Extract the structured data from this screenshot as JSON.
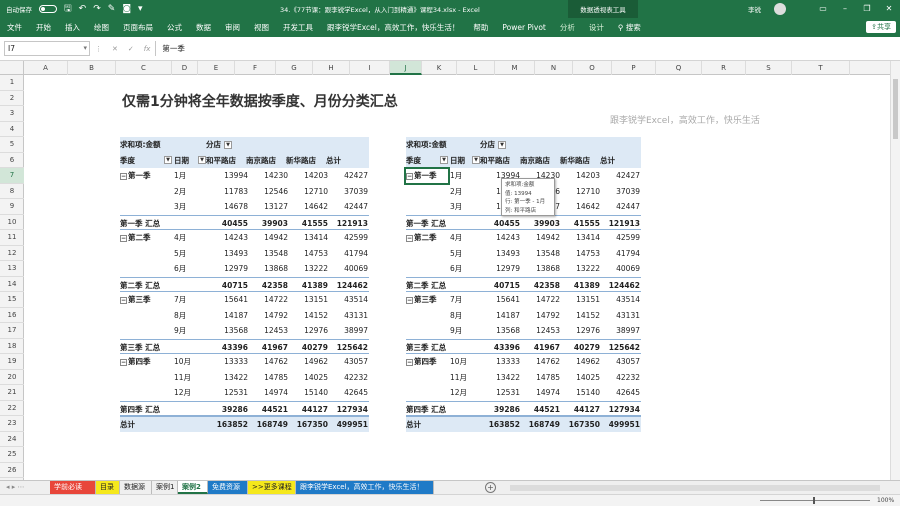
{
  "titlebar": {
    "autosave_label": "自动保存",
    "toggle_state": "关",
    "document_title": "34.《77节课：跟李锐学Excel，从入门到精通》课程34.xlsx - Excel",
    "context_tab_group": "数据透视表工具",
    "user_name": "李锐"
  },
  "ribbon": {
    "tabs": [
      "文件",
      "开始",
      "插入",
      "绘图",
      "页面布局",
      "公式",
      "数据",
      "审阅",
      "视图",
      "开发工具",
      "跟李锐学Excel，高效工作，快乐生活！",
      "帮助",
      "Power Pivot"
    ],
    "context_tabs": [
      "分析",
      "设计"
    ],
    "search_label": "搜索",
    "share_label": "共享"
  },
  "formula_bar": {
    "name_box": "I7",
    "value": "第一季"
  },
  "columns": [
    "A",
    "B",
    "C",
    "D",
    "E",
    "F",
    "G",
    "H",
    "I",
    "J",
    "K",
    "L",
    "M",
    "N",
    "O",
    "P",
    "Q",
    "R",
    "S",
    "T"
  ],
  "selected_column": "J",
  "rows": [
    "1",
    "2",
    "3",
    "4",
    "5",
    "6",
    "7",
    "8",
    "9",
    "10",
    "11",
    "12",
    "13",
    "14",
    "15",
    "16",
    "17",
    "18",
    "19",
    "20",
    "21",
    "22",
    "23",
    "24",
    "25",
    "26"
  ],
  "selected_row": "7",
  "sheet": {
    "title": "仅需1分钟将全年数据按季度、月份分类汇总",
    "subtitle": "跟李锐学Excel，高效工作，快乐生活"
  },
  "pivot": {
    "value_field": "求和项:金额",
    "column_field": "分店",
    "row_field_1": "季度",
    "row_field_2": "日期",
    "stores": [
      "和平路店",
      "南京路店",
      "新华路店"
    ],
    "grand_total_label": "总计",
    "rows": [
      {
        "kind": "data",
        "quarter": "第一季",
        "month": "1月",
        "v": [
          "13994",
          "14230",
          "14203",
          "42427"
        ]
      },
      {
        "kind": "data",
        "quarter": "",
        "month": "2月",
        "v": [
          "11783",
          "12546",
          "12710",
          "37039"
        ]
      },
      {
        "kind": "data",
        "quarter": "",
        "month": "3月",
        "v": [
          "14678",
          "13127",
          "14642",
          "42447"
        ]
      },
      {
        "kind": "sub",
        "quarter": "第一季 汇总",
        "month": "",
        "v": [
          "40455",
          "39903",
          "41555",
          "121913"
        ]
      },
      {
        "kind": "data",
        "quarter": "第二季",
        "month": "4月",
        "v": [
          "14243",
          "14942",
          "13414",
          "42599"
        ]
      },
      {
        "kind": "data",
        "quarter": "",
        "month": "5月",
        "v": [
          "13493",
          "13548",
          "14753",
          "41794"
        ]
      },
      {
        "kind": "data",
        "quarter": "",
        "month": "6月",
        "v": [
          "12979",
          "13868",
          "13222",
          "40069"
        ]
      },
      {
        "kind": "sub",
        "quarter": "第二季 汇总",
        "month": "",
        "v": [
          "40715",
          "42358",
          "41389",
          "124462"
        ]
      },
      {
        "kind": "data",
        "quarter": "第三季",
        "month": "7月",
        "v": [
          "15641",
          "14722",
          "13151",
          "43514"
        ]
      },
      {
        "kind": "data",
        "quarter": "",
        "month": "8月",
        "v": [
          "14187",
          "14792",
          "14152",
          "43131"
        ]
      },
      {
        "kind": "data",
        "quarter": "",
        "month": "9月",
        "v": [
          "13568",
          "12453",
          "12976",
          "38997"
        ]
      },
      {
        "kind": "sub",
        "quarter": "第三季 汇总",
        "month": "",
        "v": [
          "43396",
          "41967",
          "40279",
          "125642"
        ]
      },
      {
        "kind": "data",
        "quarter": "第四季",
        "month": "10月",
        "v": [
          "13333",
          "14762",
          "14962",
          "43057"
        ]
      },
      {
        "kind": "data",
        "quarter": "",
        "month": "11月",
        "v": [
          "13422",
          "14785",
          "14025",
          "42232"
        ]
      },
      {
        "kind": "data",
        "quarter": "",
        "month": "12月",
        "v": [
          "12531",
          "14974",
          "15140",
          "42645"
        ]
      },
      {
        "kind": "sub",
        "quarter": "第四季 汇总",
        "month": "",
        "v": [
          "39286",
          "44521",
          "44127",
          "127934"
        ]
      },
      {
        "kind": "total",
        "quarter": "总计",
        "month": "",
        "v": [
          "163852",
          "168749",
          "167350",
          "499951"
        ]
      }
    ]
  },
  "tooltip": {
    "line1": "求和项:金额",
    "line2": "值: 13994",
    "line3": "行: 第一季 - 1月",
    "line4": "列: 和平路店"
  },
  "sheet_tabs": [
    {
      "label": "学前必读",
      "bg": "#e8463a",
      "fg": "#ffffff"
    },
    {
      "label": "目录",
      "bg": "#f5e81c",
      "fg": "#222222"
    },
    {
      "label": "数据源",
      "bg": "#efefef",
      "fg": "#222222"
    },
    {
      "label": "案例1",
      "bg": "#efefef",
      "fg": "#222222"
    },
    {
      "label": "案例2",
      "bg": "#ffffff",
      "fg": "#217346"
    },
    {
      "label": "免费资源",
      "bg": "#1f7ac7",
      "fg": "#ffffff"
    },
    {
      "label": ">>更多课程",
      "bg": "#f5e81c",
      "fg": "#222222"
    },
    {
      "label": "跟李锐学Excel，高效工作，快乐生活！",
      "bg": "#1f7ac7",
      "fg": "#ffffff"
    }
  ],
  "active_sheet": "案例2",
  "status": {
    "zoom": "100%"
  },
  "colors": {
    "excel_green": "#217346",
    "pivot_header_bg": "#dde9f5",
    "pivot_border": "#8eb1d6"
  }
}
